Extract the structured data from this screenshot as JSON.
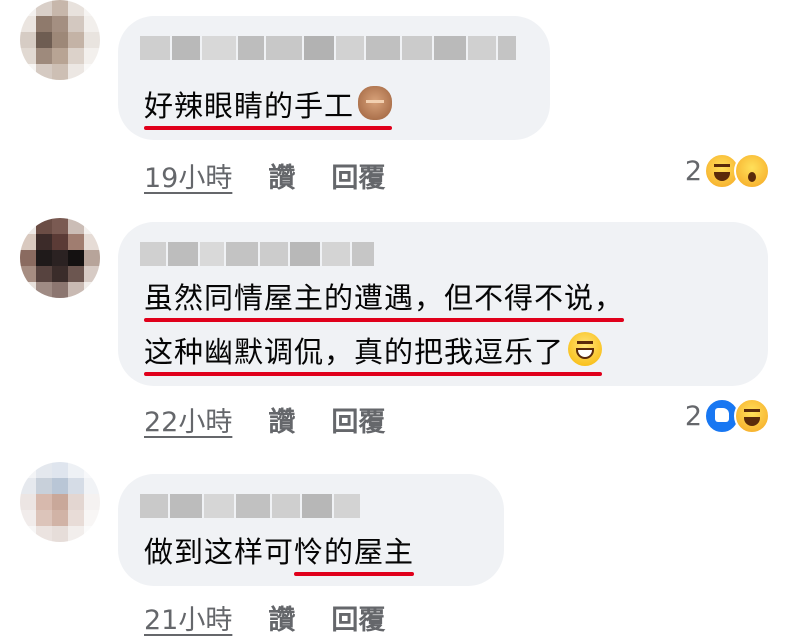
{
  "comments": [
    {
      "lines": [
        "好辣眼睛的手工"
      ],
      "time": "19小時",
      "like_label": "讚",
      "reply_label": "回覆",
      "reaction_count": "2",
      "reactions": [
        "haha-icon",
        "wow-icon"
      ]
    },
    {
      "lines": [
        "虽然同情屋主的遭遇，但不得不说，",
        "这种幽默调侃，真的把我逗乐了"
      ],
      "time": "22小時",
      "like_label": "讚",
      "reply_label": "回覆",
      "reaction_count": "2",
      "reactions": [
        "like-icon",
        "haha-icon"
      ]
    },
    {
      "lines": [
        "做到这样可怜的屋主"
      ],
      "time": "21小時",
      "like_label": "讚",
      "reply_label": "回覆",
      "reaction_count": "",
      "reactions": []
    }
  ],
  "colors": {
    "bubble": "#f0f2f5",
    "underline": "#e0001b",
    "meta_text": "#65676b",
    "like_blue": "#1877f2"
  }
}
